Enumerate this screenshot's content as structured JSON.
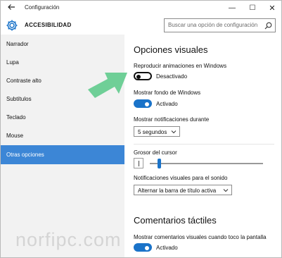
{
  "window": {
    "title": "Configuración",
    "min": "—",
    "max": "☐",
    "close": "✕"
  },
  "header": {
    "section": "ACCESIBILIDAD",
    "search_placeholder": "Buscar una opción de configuración"
  },
  "sidebar": {
    "items": [
      {
        "label": "Narrador",
        "selected": false
      },
      {
        "label": "Lupa",
        "selected": false
      },
      {
        "label": "Contraste alto",
        "selected": false
      },
      {
        "label": "Subtítulos",
        "selected": false
      },
      {
        "label": "Teclado",
        "selected": false
      },
      {
        "label": "Mouse",
        "selected": false
      },
      {
        "label": "Otras opciones",
        "selected": true
      }
    ]
  },
  "main": {
    "visual_title": "Opciones visuales",
    "animations": {
      "label": "Reproducir animaciones en Windows",
      "state": "Desactivado",
      "on": false
    },
    "background": {
      "label": "Mostrar fondo de Windows",
      "state": "Activado",
      "on": true
    },
    "notifications": {
      "label": "Mostrar notificaciones durante",
      "value": "5 segundos"
    },
    "cursor": {
      "label": "Grosor del cursor",
      "level": 0.17
    },
    "sound": {
      "label": "Notificaciones visuales para el sonido",
      "value": "Alternar la barra de título activa"
    },
    "touch_title": "Comentarios táctiles",
    "touch": {
      "label": "Mostrar comentarios visuales cuando toco la pantalla",
      "state": "Activado",
      "on": true
    }
  },
  "watermark": "norfipc.com",
  "colors": {
    "accent": "#1a73c9",
    "selected": "#3c86d6",
    "sidebar_bg": "#f2f2f2",
    "arrow": "#6fcf97"
  }
}
